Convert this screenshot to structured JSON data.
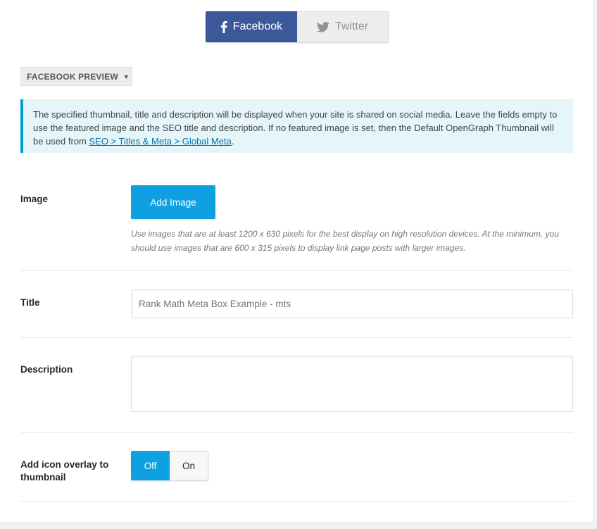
{
  "tabs": {
    "facebook_label": "Facebook",
    "twitter_label": "Twitter",
    "active": "facebook"
  },
  "preview": {
    "label": "FACEBOOK PREVIEW"
  },
  "notice": {
    "text_before_link": "The specified thumbnail, title and description will be displayed when your site is shared on social media. Leave the fields empty to use the featured image and the SEO title and description. If no featured image is set, then the Default OpenGraph Thumbnail will be used from ",
    "link_text": "SEO > Titles & Meta > Global Meta",
    "text_after_link": "."
  },
  "image_field": {
    "label": "Image",
    "button_label": "Add Image",
    "hint": "Use images that are at least 1200 x 630 pixels for the best display on high resolution devices. At the minimum, you should use images that are 600 x 315 pixels to display link page posts with larger images."
  },
  "title_field": {
    "label": "Title",
    "placeholder": "Rank Math Meta Box Example - mts"
  },
  "description_field": {
    "label": "Description",
    "value": ""
  },
  "overlay_field": {
    "label_line1": "Add icon overlay to",
    "label_line2": "thumbnail",
    "off_label": "Off",
    "on_label": "On",
    "selected": "Off"
  },
  "colors": {
    "facebook": "#3b5998",
    "accent": "#0ea0e0",
    "notice_border": "#00a0d2",
    "notice_bg": "#e5f5fa"
  }
}
